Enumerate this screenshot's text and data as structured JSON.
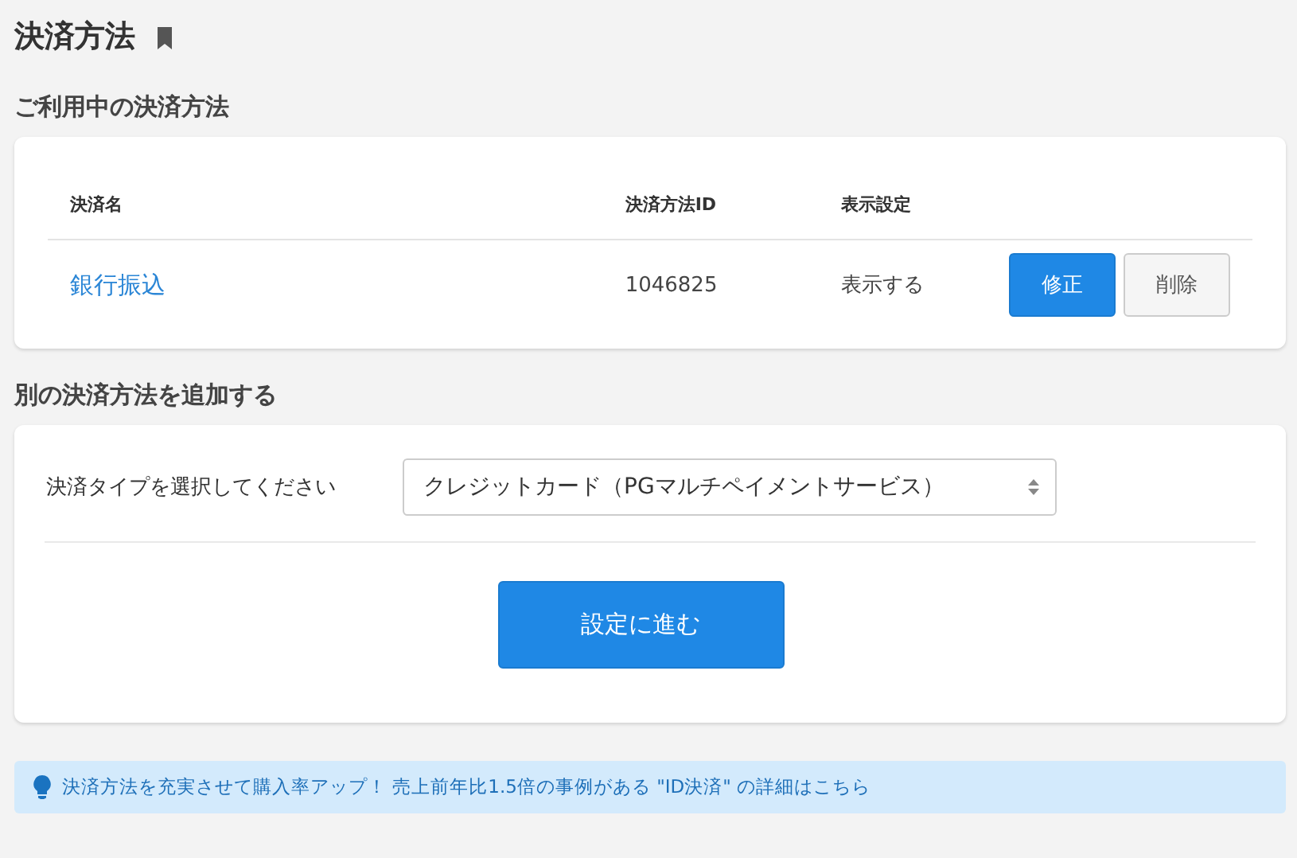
{
  "page_title": "決済方法",
  "current_section": {
    "heading": "ご利用中の決済方法",
    "columns": [
      "決済名",
      "決済方法ID",
      "表示設定"
    ],
    "rows": [
      {
        "name": "銀行振込",
        "id": "1046825",
        "display": "表示する",
        "edit_button": "修正",
        "delete_button": "削除"
      }
    ]
  },
  "add_section": {
    "heading": "別の決済方法を追加する",
    "label": "決済タイプを選択してください",
    "select_value": "クレジットカード（PGマルチペイメントサービス）",
    "submit_button": "設定に進む"
  },
  "tip": "決済方法を充実させて購入率アップ！ 売上前年比1.5倍の事例がある \"ID決済\" の詳細はこちら"
}
